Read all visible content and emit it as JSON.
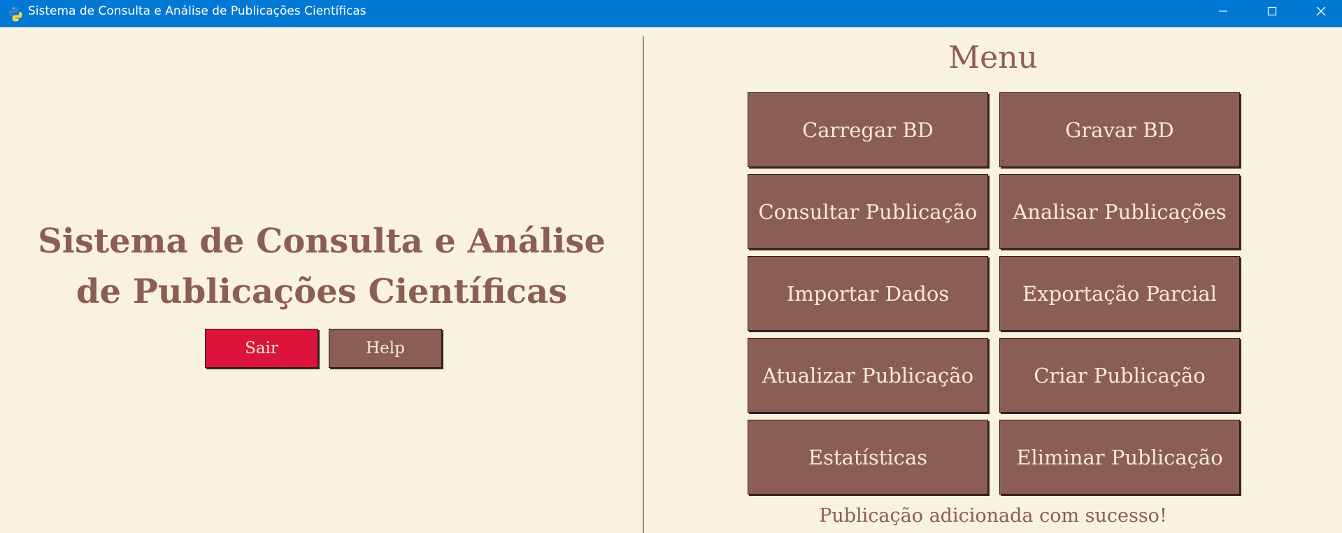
{
  "window": {
    "title": "Sistema de Consulta e Análise de Publicações Científicas",
    "icon": "python-icon",
    "controls": [
      "minimize-icon",
      "maximize-icon",
      "close-icon"
    ]
  },
  "left": {
    "title": "Sistema de Consulta e Análise de Publicações Científicas",
    "buttons": {
      "exit_label": "Sair",
      "help_label": "Help"
    }
  },
  "menu": {
    "title": "Menu",
    "buttons": [
      "Carregar BD",
      "Gravar BD",
      "Consultar Publicação",
      "Analisar Publicações",
      "Importar Dados",
      "Exportação Parcial",
      "Atualizar Publicação",
      "Criar Publicação",
      "Estatísticas",
      "Eliminar Publicação"
    ]
  },
  "status": {
    "message": "Publicação adicionada com sucesso!"
  },
  "colors": {
    "titlebar": "#0078d4",
    "background": "#faf2e0",
    "button": "#8b5e55",
    "button_text": "#f7ead5",
    "exit_button": "#dc143c",
    "title_text": "#8b5e55"
  }
}
